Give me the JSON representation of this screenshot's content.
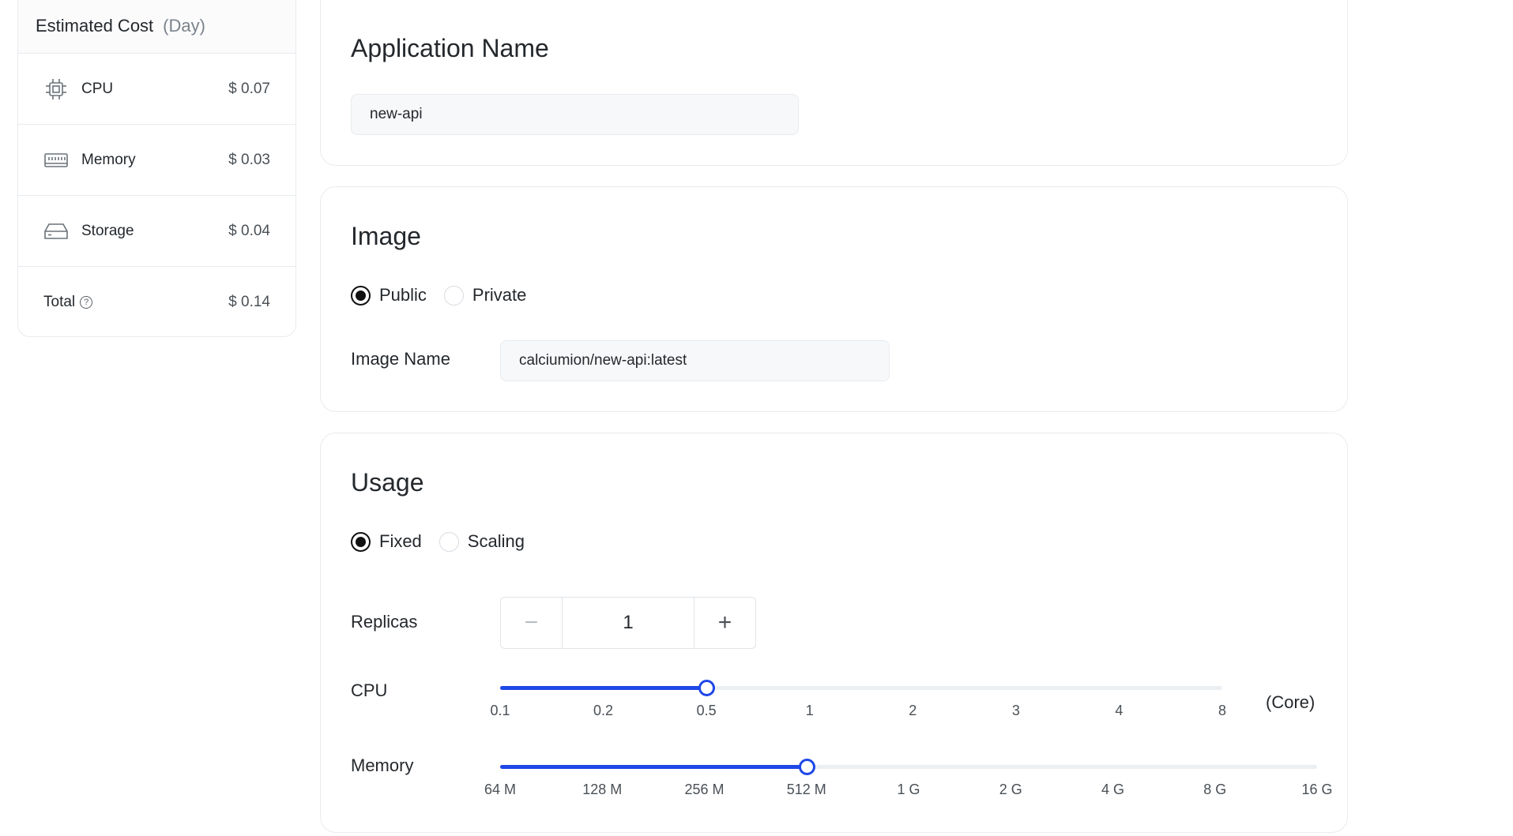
{
  "cost": {
    "title": "Estimated Cost",
    "period": "(Day)",
    "items": [
      {
        "icon": "cpu-chip-icon",
        "label": "CPU",
        "value": "$ 0.07"
      },
      {
        "icon": "memory-module-icon",
        "label": "Memory",
        "value": "$ 0.03"
      },
      {
        "icon": "storage-drive-icon",
        "label": "Storage",
        "value": "$ 0.04"
      }
    ],
    "total": {
      "label": "Total",
      "help_icon": "question-circle-icon",
      "value": "$ 0.14"
    }
  },
  "app": {
    "title": "Application Name",
    "name_value": "new-api"
  },
  "image": {
    "title": "Image",
    "options": [
      "Public",
      "Private"
    ],
    "selected": "Public",
    "name_label": "Image Name",
    "name_value": "calciumion/new-api:latest"
  },
  "usage": {
    "title": "Usage",
    "options": [
      "Fixed",
      "Scaling"
    ],
    "selected": "Fixed",
    "replicas_label": "Replicas",
    "replicas_value": "1",
    "minus_icon": "minus-icon",
    "plus_icon": "plus-icon",
    "cpu": {
      "label": "CPU",
      "ticks": [
        "0.1",
        "0.2",
        "0.5",
        "1",
        "2",
        "3",
        "4",
        "8"
      ],
      "selected_index": 2,
      "unit": "(Core)"
    },
    "memory": {
      "label": "Memory",
      "ticks": [
        "64 M",
        "128 M",
        "256 M",
        "512 M",
        "1 G",
        "2 G",
        "4 G",
        "8 G",
        "16 G"
      ],
      "selected_index": 3
    }
  },
  "colors": {
    "accent": "#1e47e8",
    "border": "#e8ebef",
    "text": "#24282c"
  }
}
